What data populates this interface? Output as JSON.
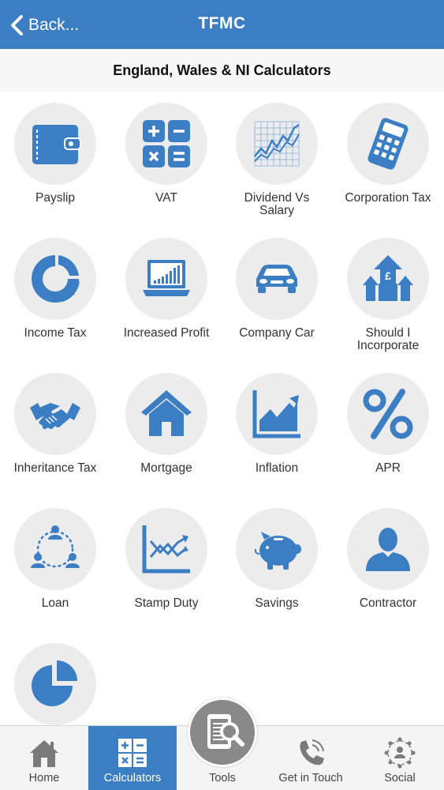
{
  "navbar": {
    "back_label": "Back...",
    "title": "TFMC"
  },
  "subheader": {
    "title": "England, Wales & NI Calculators"
  },
  "calculators": [
    {
      "label": "Payslip",
      "icon": "wallet-icon"
    },
    {
      "label": "VAT",
      "icon": "calculator-symbols-icon"
    },
    {
      "label": "Dividend Vs\nSalary",
      "icon": "line-graph-icon"
    },
    {
      "label": "Corporation Tax",
      "icon": "calculator-icon"
    },
    {
      "label": "Income Tax",
      "icon": "donut-chart-icon"
    },
    {
      "label": "Increased Profit",
      "icon": "laptop-chart-icon"
    },
    {
      "label": "Company Car",
      "icon": "car-icon"
    },
    {
      "label": "Should I\nIncorporate",
      "icon": "pound-house-arrows-icon"
    },
    {
      "label": "Inheritance Tax",
      "icon": "handshake-icon"
    },
    {
      "label": "Mortgage",
      "icon": "house-icon"
    },
    {
      "label": "Inflation",
      "icon": "area-chart-icon"
    },
    {
      "label": "APR",
      "icon": "percent-icon"
    },
    {
      "label": "Loan",
      "icon": "people-network-icon"
    },
    {
      "label": "Stamp Duty",
      "icon": "trend-chart-icon"
    },
    {
      "label": "Savings",
      "icon": "piggy-bank-icon"
    },
    {
      "label": "Contractor",
      "icon": "person-icon"
    },
    {
      "label": "",
      "icon": "pie-chart-icon"
    }
  ],
  "tabbar": {
    "active": "calculators",
    "tabs": [
      {
        "id": "home",
        "label": "Home",
        "icon": "house-icon"
      },
      {
        "id": "calculators",
        "label": "Calculators",
        "icon": "calculator-symbols-icon"
      },
      {
        "id": "tools",
        "label": "Tools",
        "icon": "document-search-icon"
      },
      {
        "id": "get-in-touch",
        "label": "Get in Touch",
        "icon": "phone-icon"
      },
      {
        "id": "social",
        "label": "Social",
        "icon": "network-icon"
      }
    ]
  },
  "colors": {
    "brand_blue": "#3b7ec4",
    "icon_circle": "#ececec",
    "tab_bar": "#f4f4f4",
    "tools_button": "#898989"
  }
}
